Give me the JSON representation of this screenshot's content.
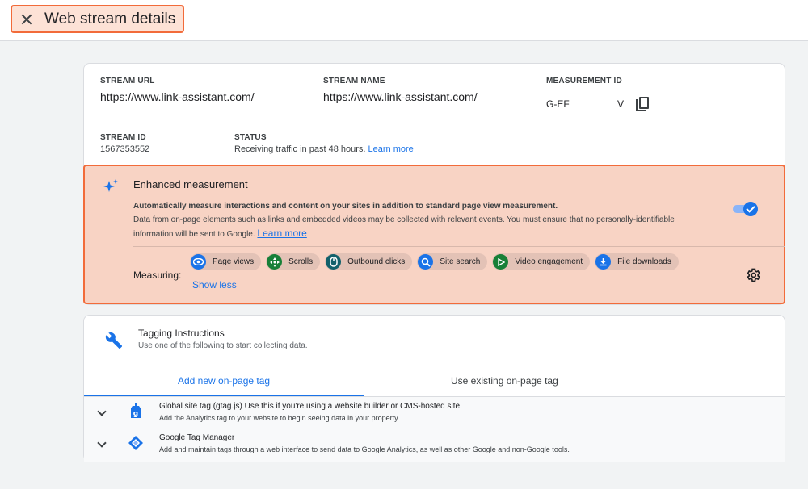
{
  "header": {
    "title": "Web stream details"
  },
  "stream": {
    "url_label": "STREAM URL",
    "url_value": "https://www.link-assistant.com/",
    "name_label": "STREAM NAME",
    "name_value": "https://www.link-assistant.com/",
    "mid_label": "MEASUREMENT ID",
    "mid_prefix": "G-EF",
    "mid_suffix": "V",
    "id_label": "STREAM ID",
    "id_value": "1567353552",
    "status_label": "STATUS",
    "status_value": "Receiving traffic in past 48 hours.",
    "status_link": "Learn more"
  },
  "enhanced": {
    "title": "Enhanced measurement",
    "desc_bold": "Automatically measure interactions and content on your sites in addition to standard page view measurement.",
    "desc": "Data from on-page elements such as links and embedded videos may be collected with relevant events. You must ensure that no personally-identifiable information will be sent to Google.",
    "learn_more": "Learn more",
    "measuring_label": "Measuring:",
    "chips": [
      "Page views",
      "Scrolls",
      "Outbound clicks",
      "Site search",
      "Video engagement",
      "File downloads"
    ],
    "show_less": "Show less",
    "toggle_on": true
  },
  "tagging": {
    "title": "Tagging Instructions",
    "subtitle": "Use one of the following to start collecting data.",
    "tab_new": "Add new on-page tag",
    "tab_existing": "Use existing on-page tag",
    "rows": [
      {
        "title_strong": "Global site tag (gtag.js)",
        "title_rest": "Use this if you're using a website builder or CMS-hosted site",
        "desc": "Add the Analytics tag to your website to begin seeing data in your property."
      },
      {
        "title_strong": "Google Tag Manager",
        "title_rest": "",
        "desc": "Add and maintain tags through a web interface to send data to Google Analytics, as well as other Google and non-Google tools."
      }
    ]
  },
  "colors": {
    "accent": "#1a73e8",
    "highlight_border": "#f26b3a",
    "highlight_bg": "#f8d3c4"
  }
}
